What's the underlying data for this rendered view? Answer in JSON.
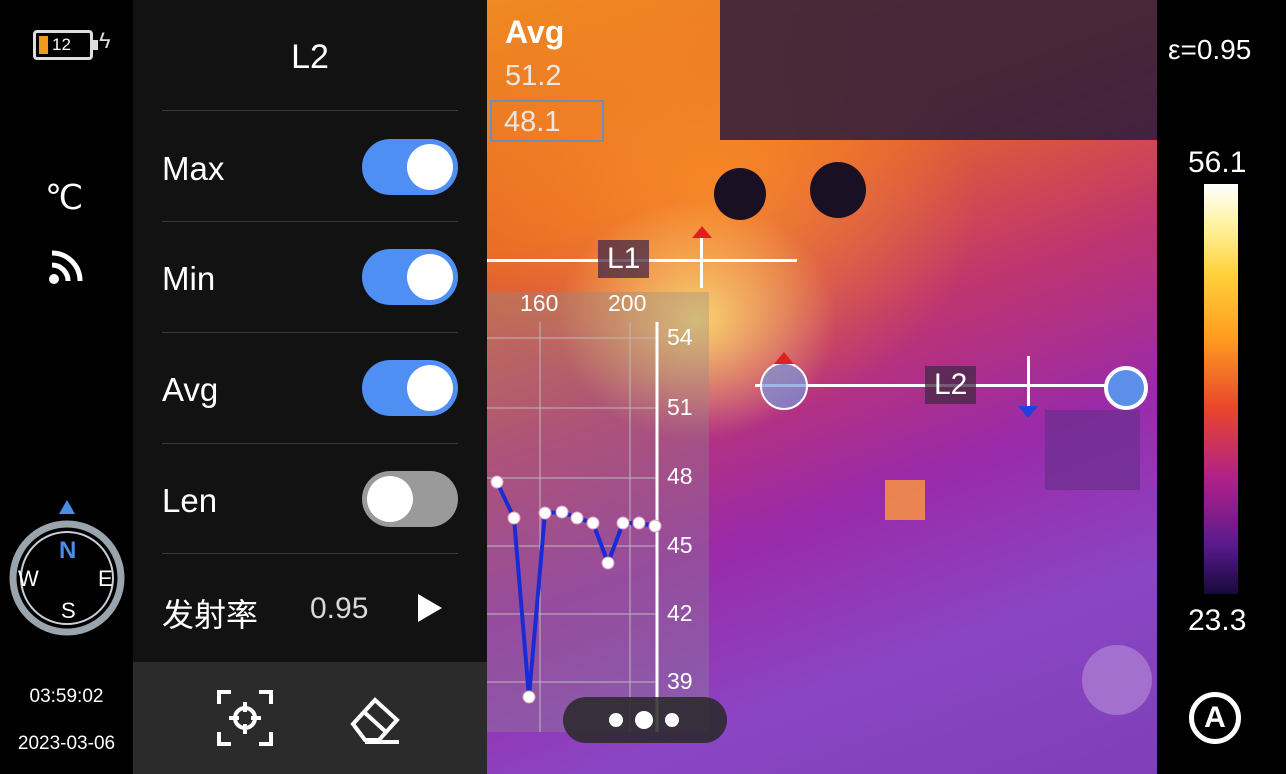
{
  "status": {
    "battery_level": "12",
    "temperature_unit": "℃",
    "time": "03:59:02",
    "date": "2023-03-06",
    "compass": {
      "n": "N",
      "e": "E",
      "s": "S",
      "w": "W"
    }
  },
  "right": {
    "emissivity": "ε=0.95",
    "scale_max": "56.1",
    "scale_min": "23.3",
    "auto_label": "A"
  },
  "panel": {
    "title": "L2",
    "rows": [
      {
        "label": "Max",
        "on": true
      },
      {
        "label": "Min",
        "on": true
      },
      {
        "label": "Avg",
        "on": true
      },
      {
        "label": "Len",
        "on": false
      }
    ],
    "emissivity_label": "发射率",
    "emissivity_value": "0.95"
  },
  "stats": {
    "header": "Avg",
    "values": [
      "51.2",
      "48.1"
    ]
  },
  "lines": {
    "l1": "L1",
    "l2": "L2"
  },
  "graph": {
    "x_ticks": [
      "160",
      "200"
    ],
    "y_ticks": [
      "54",
      "51",
      "48",
      "45",
      "42",
      "39"
    ]
  },
  "icons": {
    "battery": "battery-icon",
    "charging": "charging-icon",
    "wifi": "wifi-icon",
    "compass": "compass-icon",
    "target": "target-icon",
    "eraser": "eraser-icon",
    "play": "play-icon",
    "auto": "auto-icon"
  },
  "colors": {
    "accent": "#4f8ff4",
    "panel_bg": "#141414",
    "graph_line": "#1a2bd6"
  }
}
